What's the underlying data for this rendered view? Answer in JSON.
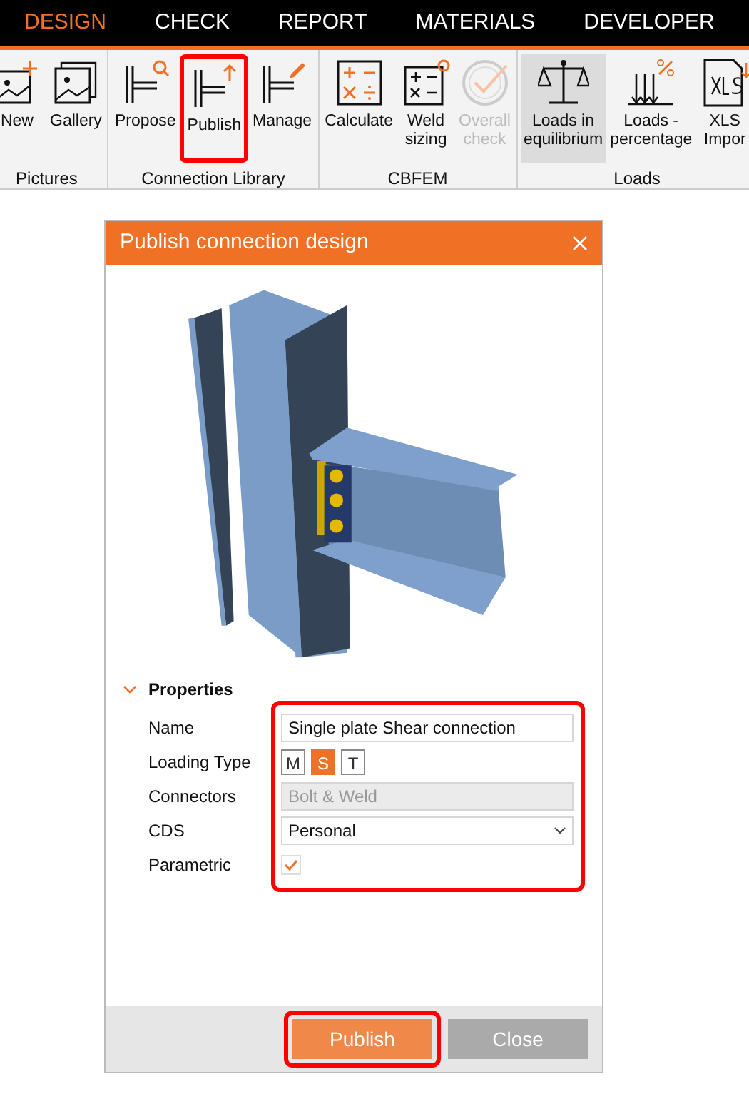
{
  "tabs": [
    {
      "label": "DESIGN",
      "selected": true
    },
    {
      "label": "CHECK",
      "selected": false
    },
    {
      "label": "REPORT",
      "selected": false
    },
    {
      "label": "MATERIALS",
      "selected": false
    },
    {
      "label": "DEVELOPER",
      "selected": false
    }
  ],
  "ribbon": [
    {
      "label": "Pictures",
      "buttons": [
        {
          "kind": "new-picture",
          "label": "New",
          "disabled": false,
          "selected": false,
          "highlighted": false
        },
        {
          "kind": "gallery",
          "label": "Gallery",
          "disabled": false,
          "selected": false,
          "highlighted": false
        }
      ]
    },
    {
      "label": "Connection Library",
      "buttons": [
        {
          "kind": "propose",
          "label": "Propose",
          "disabled": false,
          "selected": false,
          "highlighted": false
        },
        {
          "kind": "publish",
          "label": "Publish",
          "disabled": false,
          "selected": false,
          "highlighted": true
        },
        {
          "kind": "manage",
          "label": "Manage",
          "disabled": false,
          "selected": false,
          "highlighted": false
        }
      ]
    },
    {
      "label": "CBFEM",
      "buttons": [
        {
          "kind": "calculate",
          "label": "Calculate",
          "disabled": false,
          "selected": false,
          "highlighted": false
        },
        {
          "kind": "weld",
          "label": "Weld sizing",
          "disabled": false,
          "selected": false,
          "highlighted": false
        },
        {
          "kind": "check",
          "label": "Overall check",
          "disabled": true,
          "selected": false,
          "highlighted": false
        }
      ]
    },
    {
      "label": "Loads",
      "buttons": [
        {
          "kind": "scales",
          "label": "Loads in equilibrium",
          "disabled": false,
          "selected": true,
          "highlighted": false
        },
        {
          "kind": "percentage",
          "label": "Loads - percentage",
          "disabled": false,
          "selected": false,
          "highlighted": false
        },
        {
          "kind": "xls",
          "label": "XLS Impor",
          "disabled": false,
          "selected": false,
          "highlighted": false
        }
      ]
    }
  ],
  "dialog": {
    "title": "Publish connection design",
    "properties": {
      "heading": "Properties",
      "expanded": true,
      "highlighted": true,
      "rows": [
        {
          "kind": "text",
          "label": "Name",
          "value": "Single plate Shear connection"
        },
        {
          "kind": "toggles",
          "label": "Loading Type",
          "options": [
            {
              "label": "M",
              "selected": false
            },
            {
              "label": "S",
              "selected": true
            },
            {
              "label": "T",
              "selected": false
            }
          ]
        },
        {
          "kind": "readonly",
          "label": "Connectors",
          "value": "Bolt & Weld"
        },
        {
          "kind": "select",
          "label": "CDS",
          "value": "Personal"
        },
        {
          "kind": "checkbox",
          "label": "Parametric",
          "checked": true
        }
      ]
    },
    "buttons": [
      {
        "kind": "primary",
        "label": "Publish",
        "highlighted": true
      },
      {
        "kind": "secondary",
        "label": "Close",
        "highlighted": false
      }
    ]
  }
}
